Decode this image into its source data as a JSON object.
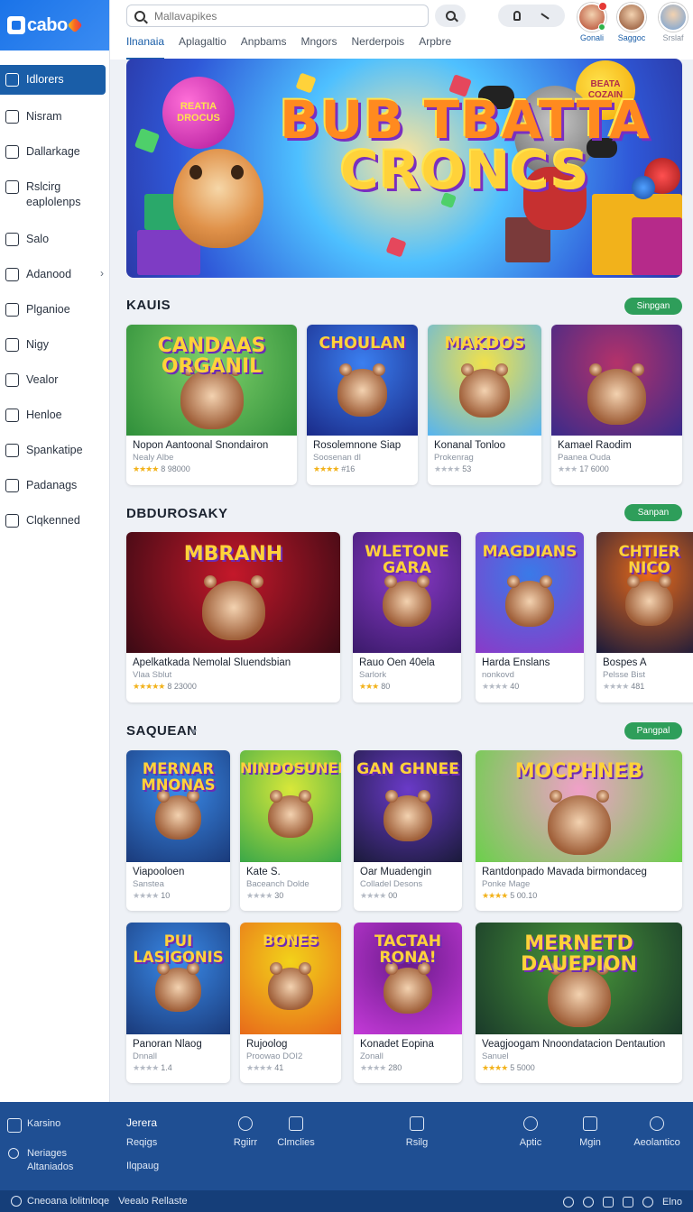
{
  "app": {
    "logo_text": "cabo"
  },
  "sidebar": {
    "items": [
      {
        "label": "Idlorers",
        "icon": "home-icon",
        "active": true
      },
      {
        "label": "Nisram",
        "icon": "tag-icon"
      },
      {
        "label": "Dallarkage",
        "icon": "package-icon"
      },
      {
        "label": "Rslcirg eaplolenps",
        "icon": "pin-icon"
      },
      {
        "label": "Salo",
        "icon": "chart-icon"
      },
      {
        "label": "Adanood",
        "icon": "box-icon",
        "chevron": true
      },
      {
        "label": "Plganioe",
        "icon": "document-icon"
      },
      {
        "label": "Nigy",
        "icon": "graph-icon"
      },
      {
        "label": "Vealor",
        "icon": "lock-icon"
      },
      {
        "label": "Henloe",
        "icon": "house-icon"
      },
      {
        "label": "Spankatipe",
        "icon": "clock-icon"
      },
      {
        "label": "Padanags",
        "icon": "folder-icon"
      },
      {
        "label": "Clqkenned",
        "icon": "info-icon"
      }
    ]
  },
  "header": {
    "search_placeholder": "Mallavapikes",
    "tabs": [
      "Ilnanaia",
      "Aplagaltio",
      "Anpbams",
      "Mngors",
      "Nerderpois",
      "Arpbre"
    ],
    "active_tab": 0,
    "users": [
      {
        "label": "Gonali",
        "badge": true,
        "online": true,
        "color": "#b2432a"
      },
      {
        "label": "Saggoc",
        "color": "#8a4a2b"
      },
      {
        "label": "Srslaf",
        "color": "#6fa0d8"
      }
    ]
  },
  "hero": {
    "title_line1": "BUB TBATTA",
    "title_line2": "CRONCS",
    "bubble_left": "REATIA DROCUS",
    "bubble_right": "BEATA COZAIN"
  },
  "sections": [
    {
      "title": "KAUIS",
      "pill": "Sinpgan",
      "cards": [
        {
          "art": "CANDAAS ORGANIL",
          "title": "Nopon Aantoonal Snondairon",
          "subtitle": "Nealy Albe",
          "rating": "8 98000",
          "stars": "★★★★",
          "gold": true
        },
        {
          "art": "CHOULAN",
          "title": "Rosolemnone Siap",
          "subtitle": "Soosenan dl",
          "rating": "#16",
          "stars": "★★★★",
          "gold": true
        },
        {
          "art": "MAKDOS",
          "title": "Konanal Tonloo",
          "subtitle": "Prokenrag",
          "rating": "53",
          "stars": "★★★★",
          "gold": false
        },
        {
          "art": "",
          "title": "Kamael Raodim",
          "subtitle": "Paanea Ouda",
          "rating": "17 6000",
          "stars": "★★★",
          "gold": false
        }
      ]
    },
    {
      "title": "DBDUROSAKY",
      "pill": "Sanpan",
      "cards": [
        {
          "art": "MBRANH",
          "title": "Apelkatkada Nemolal Sluendsbian",
          "subtitle": "Vlaa Sblut",
          "rating": "8 23000",
          "stars": "★★★★★",
          "gold": true
        },
        {
          "art": "WLETONE GARA",
          "title": "Rauo Oen 40ela",
          "subtitle": "Sarlork",
          "rating": "80",
          "stars": "★★★",
          "gold": true
        },
        {
          "art": "MAGDIANS",
          "title": "Harda Enslans",
          "subtitle": "nonkovd",
          "rating": "40",
          "stars": "★★★★",
          "gold": false
        },
        {
          "art": "CHTIER NICO",
          "title": "Bospes A",
          "subtitle": "Pelsse Bist",
          "rating": "481",
          "stars": "★★★★",
          "gold": false
        }
      ]
    },
    {
      "title": "SAQUEAN",
      "pill": "Pangpal",
      "cards": [
        {
          "art": "MERNAR MNONAS",
          "title": "Viapooloen",
          "subtitle": "Sanstea",
          "rating": "10",
          "stars": "★★★★",
          "gold": false
        },
        {
          "art": "NINDOSUNEKS",
          "title": "Kate S.",
          "subtitle": "Baceanch Dolde",
          "rating": "30",
          "stars": "★★★★",
          "gold": false
        },
        {
          "art": "GAN GHNEE",
          "title": "Oar Muadengin",
          "subtitle": "Colladel Desons",
          "rating": "00",
          "stars": "★★★★",
          "gold": false
        },
        {
          "art": "MOCPHNEB",
          "title": "Rantdonpado Mavada birmondaceg",
          "subtitle": "Ponke Mage",
          "rating": "5 00.10",
          "stars": "★★★★",
          "gold": true
        },
        {
          "art": "PUI LASIGONIS",
          "title": "Panoran Nlaog",
          "subtitle": "Dnnall",
          "rating": "1.4",
          "stars": "★★★★",
          "gold": false
        },
        {
          "art": "BONES",
          "title": "Rujoolog",
          "subtitle": "Proowao DOI2",
          "rating": "41",
          "stars": "★★★★",
          "gold": false
        },
        {
          "art": "TACTAH RONA!",
          "title": "Konadet Eopina",
          "subtitle": "Zonall",
          "rating": "280",
          "stars": "★★★★",
          "gold": false
        },
        {
          "art": "MERNETD DAUEPION",
          "title": "Veagjoogam Nnoondatacion Dentaution",
          "subtitle": "Sanuel",
          "rating": "5 5000",
          "stars": "★★★★",
          "gold": true
        }
      ]
    }
  ],
  "footer": {
    "left_items": [
      "Karsino",
      "Neriages",
      "Altaniados"
    ],
    "col2": [
      "Jerera",
      "Reqigs",
      "Ilqpaug"
    ],
    "nav": [
      "Rgiirr",
      "Clmclies",
      "Rsilg",
      "Aptic",
      "Mgin",
      "Aeolantico"
    ],
    "bottom_text_1": "Cneoana lolitnloqe",
    "bottom_text_2": "Veealo Rellaste",
    "bottom_brand": "Elno"
  },
  "colors": {
    "primary": "#1a5ea8",
    "accent_green": "#2e9e5a",
    "footer": "#1f4f93",
    "star": "#f2b21b"
  }
}
